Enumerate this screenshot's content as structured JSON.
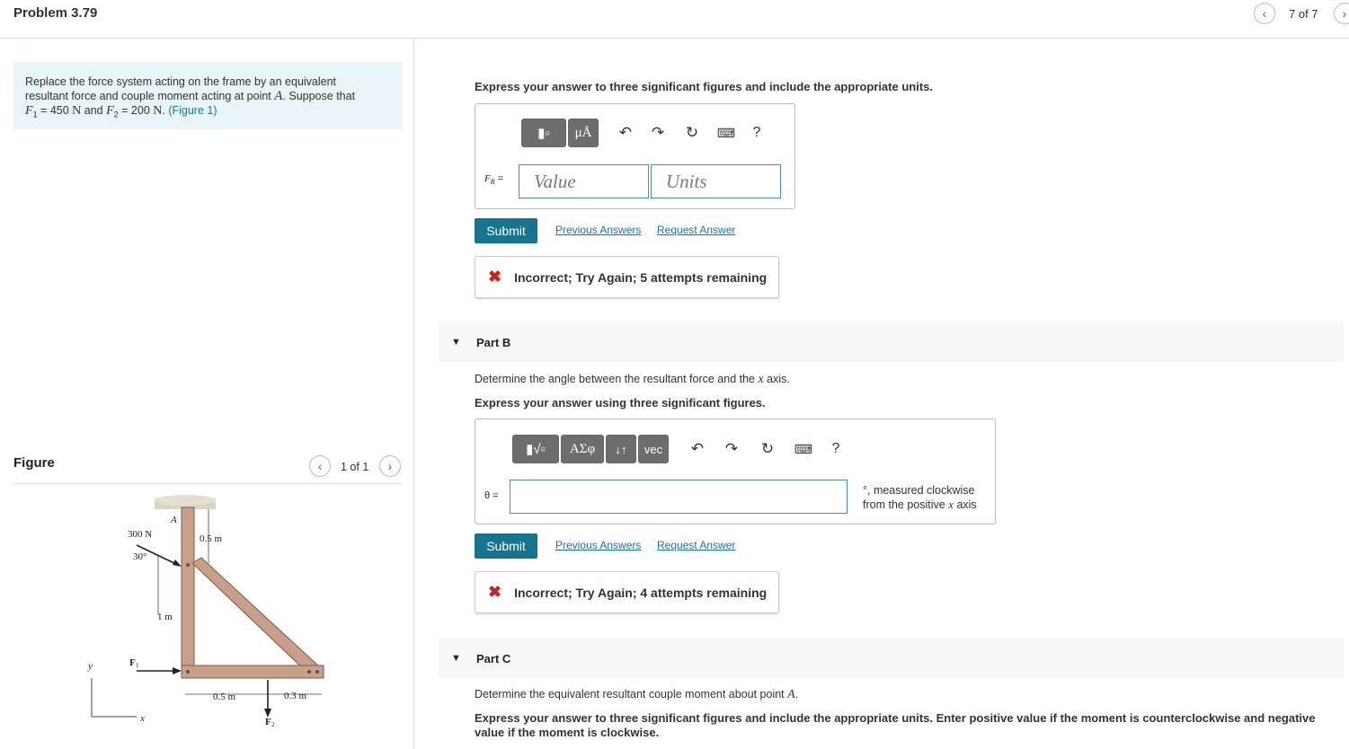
{
  "header": {
    "title": "Problem 3.79",
    "page_indicator": "7 of 7",
    "prev_icon": "chevron-left-icon",
    "next_icon": "chevron-right-icon"
  },
  "problem": {
    "text_line1": "Replace the force system acting on the frame by an equivalent",
    "text_line2a": "resultant force and couple moment acting at point ",
    "point": "A",
    "text_line2b": ". Suppose that",
    "f1_label": "F",
    "f1_sub": "1",
    "f1_value": " = 450 ",
    "f1_unit": "N",
    "and": " and ",
    "f2_label": "F",
    "f2_sub": "2",
    "f2_value": " = 200 ",
    "f2_unit": "N",
    "figure_link": "(Figure 1)"
  },
  "figure": {
    "label": "Figure",
    "pager": "1 of 1",
    "labels": {
      "force300": "300 N",
      "angle": "30°",
      "pointA": "A",
      "dim05top": "0.5 m",
      "dim1": "1 m",
      "f1": "F",
      "f1sub": "1",
      "f2": "F",
      "f2sub": "2",
      "dim05bottom": "0.5 m",
      "dim03": "0.3 m",
      "yaxis": "y",
      "xaxis": "x"
    }
  },
  "partA": {
    "instruction": "Express your answer to three significant figures and include the appropriate units.",
    "var_label": "F",
    "var_sub": "R",
    "eq": " =",
    "value_placeholder": "Value",
    "units_placeholder": "Units",
    "toolbar_mu": "μÅ",
    "toolbar_help": "?",
    "submit": "Submit",
    "previous_answers": "Previous Answers",
    "request_answer": "Request Answer",
    "feedback": "Incorrect; Try Again; 5 attempts remaining"
  },
  "partB": {
    "label": "Part B",
    "question_a": "Determine the angle between the resultant force and the ",
    "question_var": "x",
    "question_b": " axis.",
    "instruction": "Express your answer using three significant figures.",
    "toolbar_greek": "ΑΣφ",
    "toolbar_updown": "↓↑",
    "toolbar_vec": "vec",
    "toolbar_help": "?",
    "var_label": "θ =",
    "unit_note_line1": "°, measured clockwise",
    "unit_note_line2a": "from the positive ",
    "unit_note_var": "x",
    "unit_note_line2b": " axis",
    "submit": "Submit",
    "previous_answers": "Previous Answers",
    "request_answer": "Request Answer",
    "feedback": "Incorrect; Try Again; 4 attempts remaining"
  },
  "partC": {
    "label": "Part C",
    "question_a": "Determine the equivalent resultant couple moment about point ",
    "question_var": "A",
    "question_b": ".",
    "instruction": "Express your answer to three significant figures and include the appropriate units. Enter positive value if the moment is counterclockwise and negative value if the moment is clockwise."
  }
}
